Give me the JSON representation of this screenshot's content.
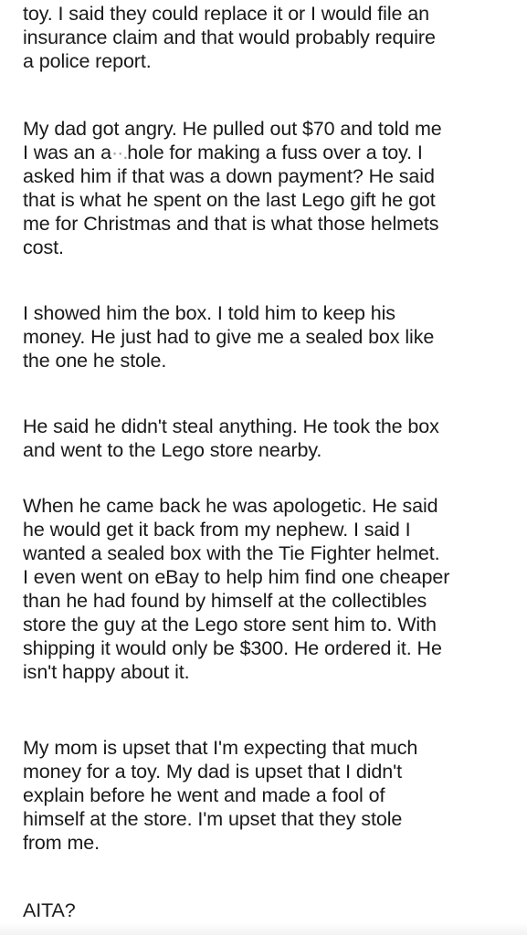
{
  "post": {
    "paragraphs": [
      {
        "lines": [
          "toy. I said they could replace it or I would file an",
          "insurance claim and that would probably require",
          "a police report."
        ]
      },
      {
        "lines": [
          "My dad got angry. He pulled out $70 and told me",
          "I was an a",
          "hole for making a fuss over a toy. I",
          "asked him if that was a down payment? He said",
          "that is what he spent on the last Lego gift he got",
          "me for Christmas and that is what those helmets",
          "cost."
        ],
        "redaction_mark": "··."
      },
      {
        "lines": [
          "I showed him the box. I told him to keep his",
          "money. He just had to give me a sealed box like",
          "the one he stole."
        ]
      },
      {
        "lines": [
          "He said he didn't steal anything. He took the box",
          "and went to the Lego store nearby."
        ]
      },
      {
        "lines": [
          "When he came back he was apologetic. He said",
          "he would get it back from my nephew. I said I",
          "wanted a sealed box with the Tie Fighter helmet.",
          "I even went on eBay to help him find one cheaper",
          "than he had found by himself at the collectibles",
          "store the guy at the Lego store sent him to. With",
          "shipping it would only be $300. He ordered it. He",
          "isn't happy about it."
        ]
      },
      {
        "lines": [
          "My mom is upset that I'm expecting that much",
          "money for a toy. My dad is upset that I didn't",
          "explain before he went and made a fool of",
          "himself at the store. I'm upset that they stole",
          "from me."
        ]
      },
      {
        "lines": [
          "AITA?"
        ]
      }
    ]
  }
}
